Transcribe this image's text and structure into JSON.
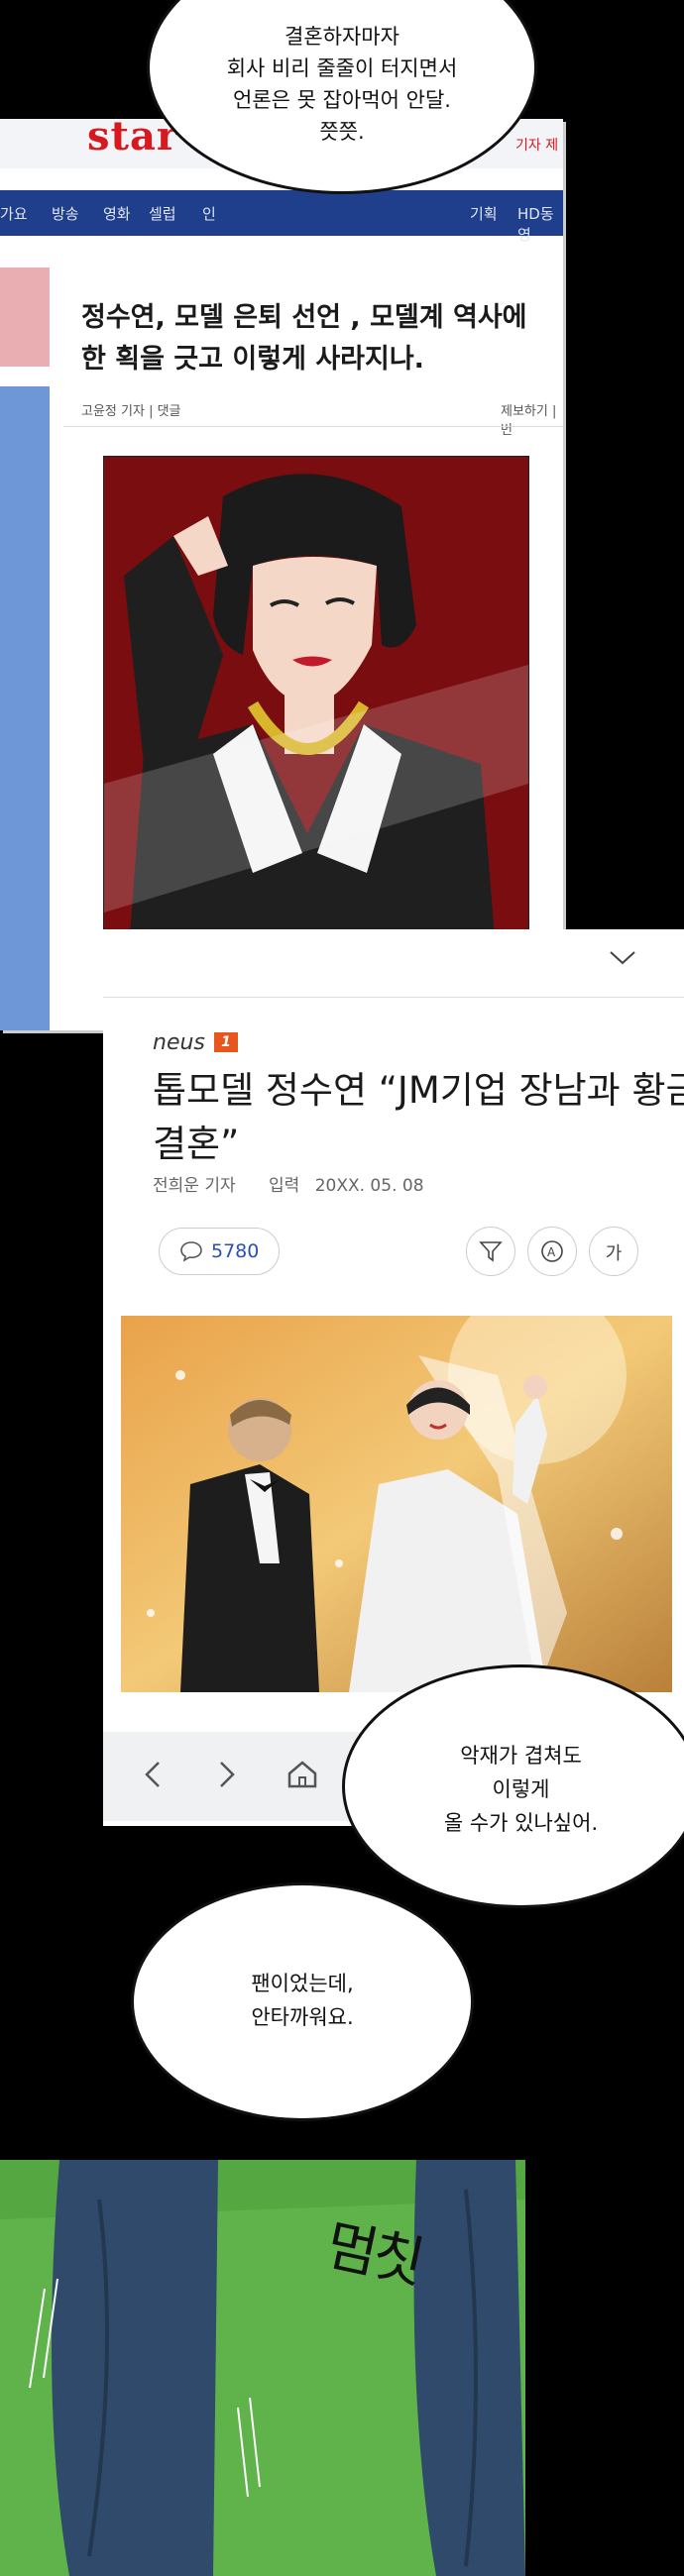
{
  "bubble_top": {
    "lines": [
      "결혼하자마자",
      "회사 비리 줄줄이 터지면서",
      "언론은 못 잡아먹어 안달.",
      "쯧쯧."
    ]
  },
  "panel_stars": {
    "logo": "star",
    "topbar_right": "기자 제",
    "nav": [
      "가요",
      "방송",
      "영화",
      "셀럽",
      "인",
      "기획",
      "HD동영"
    ],
    "headline": "정수연, 모델 은퇴 선언 , 모델계 역사에 한 획을 긋고 이렇게 사라지나.",
    "reporter": "고윤정 기자 | 댓글",
    "report_link": "제보하기 | 번"
  },
  "panel_neus": {
    "logo": "neus",
    "badge": "1",
    "headline_line1": "톱모델 정수연 “JM기업 장남과 황금빛",
    "headline_line2": "결혼”",
    "reporter": "전희운 기자",
    "date_label": "입력",
    "date": "20XX. 05. 08",
    "comment_count": "5780",
    "font_button": "가",
    "nav_more": "···"
  },
  "bubble_mid": {
    "lines": [
      "악재가 겹쳐도",
      "이렇게",
      "올 수가 있나싶어."
    ]
  },
  "bubble_low": {
    "lines": [
      "팬이었는데,",
      "안타까워요."
    ]
  },
  "sfx": "멈칫",
  "colors": {
    "stars_red": "#d71920",
    "nav_blue": "#1f3f8c",
    "comment_blue": "#2a4fb8",
    "grass": "#5fb34a"
  }
}
